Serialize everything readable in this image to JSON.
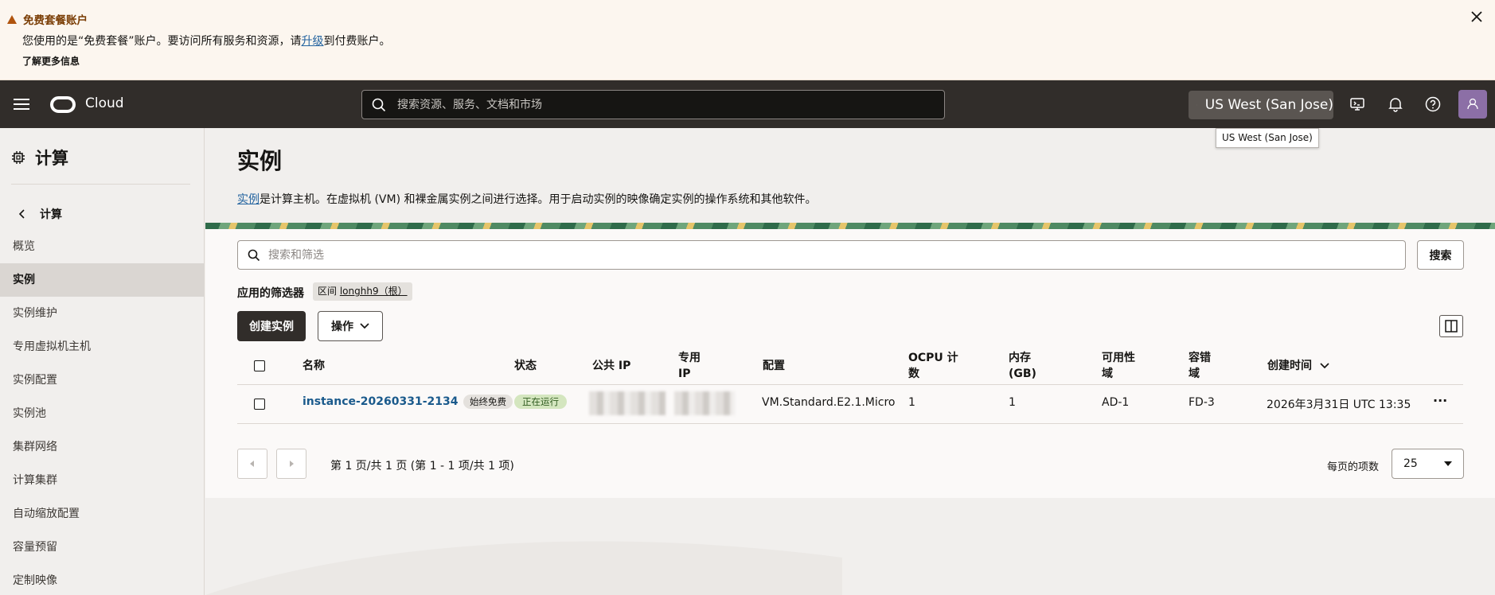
{
  "banner": {
    "title": "免费套餐账户",
    "message_pre": "您使用的是“免费套餐”账户。要访问所有服务和资源，请",
    "upgrade_link": "升级",
    "message_post": "到付费账户。",
    "learn_more": "了解更多信息"
  },
  "topbar": {
    "brand": "Cloud",
    "search_placeholder": "搜索资源、服务、文档和市场",
    "region": "US West (San Jose)",
    "region_tooltip": "US West (San Jose)"
  },
  "sidebar": {
    "title": "计算",
    "back_label": "计算",
    "items": [
      {
        "label": "概览"
      },
      {
        "label": "实例"
      },
      {
        "label": "实例维护"
      },
      {
        "label": "专用虚拟机主机"
      },
      {
        "label": "实例配置"
      },
      {
        "label": "实例池"
      },
      {
        "label": "集群网络"
      },
      {
        "label": "计算集群"
      },
      {
        "label": "自动缩放配置"
      },
      {
        "label": "容量预留"
      },
      {
        "label": "定制映像"
      }
    ]
  },
  "main": {
    "title": "实例",
    "desc_link": "实例",
    "desc_rest": "是计算主机。在虚拟机 (VM) 和裸金属实例之间进行选择。用于启动实例的映像确定实例的操作系统和其他软件。",
    "filter_placeholder": "搜索和筛选",
    "search_button": "搜索",
    "applied_filters_label": "应用的筛选器",
    "chip_prefix": "区间 ",
    "chip_value": "longhh9（根）",
    "create_button": "创建实例",
    "actions_button": "操作"
  },
  "table": {
    "columns": {
      "name": "名称",
      "status": "状态",
      "public_ip": "公共 IP",
      "private_ip_1": "专用",
      "private_ip_2": "IP",
      "shape": "配置",
      "ocpu_1": "OCPU 计",
      "ocpu_2": "数",
      "memory_1": "内存",
      "memory_2": "(GB)",
      "ad_1": "可用性",
      "ad_2": "域",
      "fd_1": "容错",
      "fd_2": "域",
      "created": "创建时间"
    },
    "rows": [
      {
        "name": "instance-20260331-2134",
        "free_badge": "始终免费",
        "status": "正在运行",
        "shape": "VM.Standard.E2.1.Micro",
        "ocpu": "1",
        "memory": "1",
        "ad": "AD-1",
        "fd": "FD-3",
        "created": "2026年3月31日 UTC 13:35",
        "more": "···"
      }
    ]
  },
  "pagination": {
    "summary": "第 1 页/共 1 页 (第 1 - 1 项/共 1 项)",
    "per_page_label": "每页的项数",
    "per_page_value": "25"
  },
  "colors": {
    "topbar": "#312d2a",
    "link": "#23639f",
    "running_badge": "#d4e6bf",
    "banner_bg": "#fcf6ef"
  }
}
